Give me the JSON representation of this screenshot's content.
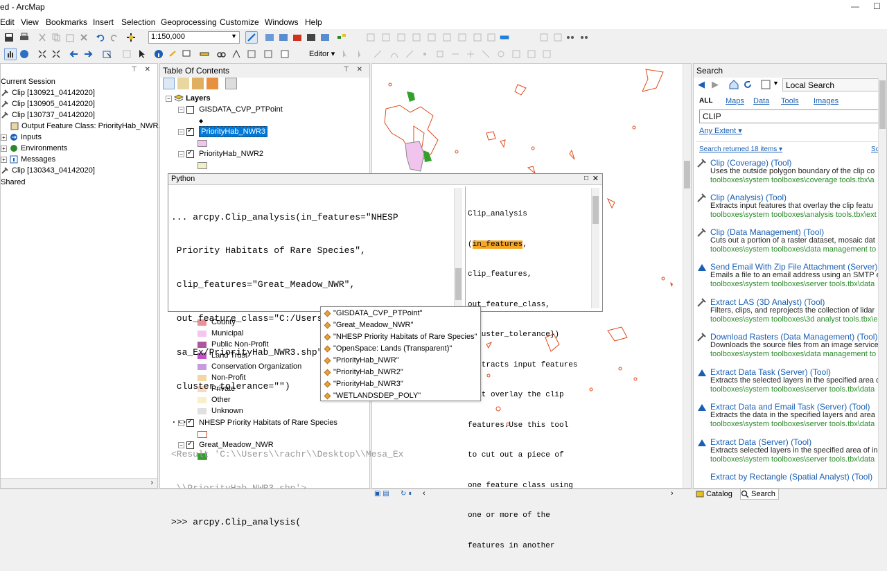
{
  "window": {
    "title": "ed - ArcMap",
    "minimize": "—",
    "maximize": "☐"
  },
  "menu": [
    "Edit",
    "View",
    "Bookmarks",
    "Insert",
    "Selection",
    "Geoprocessing",
    "Customize",
    "Windows",
    "Help"
  ],
  "toolbar": {
    "scale": "1:150,000",
    "editor_label": "Editor ▾"
  },
  "results_panel": {
    "items": [
      {
        "label": "Current Session"
      },
      {
        "label": "Clip [130921_04142020]"
      },
      {
        "label": "Clip [130905_04142020]"
      },
      {
        "label": "Clip [130737_04142020]"
      },
      {
        "label": "Output Feature Class: PriorityHab_NWR.s"
      },
      {
        "label": "Inputs"
      },
      {
        "label": "Environments"
      },
      {
        "label": "Messages"
      },
      {
        "label": "Clip [130343_04142020]"
      },
      {
        "label": "Shared"
      }
    ]
  },
  "toc": {
    "title": "Table Of Contents",
    "root": "Layers",
    "layers": [
      {
        "label": "GISDATA_CVP_PTPoint",
        "checked": false
      },
      {
        "label": "PriorityHab_NWR3",
        "checked": true
      },
      {
        "label": "PriorityHab_NWR2",
        "checked": true
      },
      {
        "label": "NHESP Priority Habitats of Rare Species",
        "checked": true
      },
      {
        "label": "Great_Meadow_NWR",
        "checked": true
      }
    ],
    "legend": [
      {
        "label": "County",
        "color": "#e8929a"
      },
      {
        "label": "Municipal",
        "color": "#f4c6f0"
      },
      {
        "label": "Public Non-Profit",
        "color": "#b0569e"
      },
      {
        "label": "Land Trust",
        "color": "#c34fc9"
      },
      {
        "label": "Conservation Organization",
        "color": "#c79be0"
      },
      {
        "label": "Non-Profit",
        "color": "#f4d6a2"
      },
      {
        "label": "Private",
        "color": "#f9d8c4"
      },
      {
        "label": "Other",
        "color": "#f8f0c8"
      },
      {
        "label": "Unknown",
        "color": "#e0e0e0"
      }
    ]
  },
  "python": {
    "title": "Python",
    "code_lines": [
      "... arcpy.Clip_analysis(in_features=\"NHESP",
      " Priority Habitats of Rare Species\",",
      " clip_features=\"Great_Meadow_NWR\",",
      " out_feature_class=\"C:/Users/rachr/Desktop/Me",
      " sa_Ex/PriorityHab_NWR3.shp\",",
      " cluster_tolerance=\"\")",
      "..."
    ],
    "result_lines": [
      "<Result 'C:\\\\Users\\\\rachr\\\\Desktop\\\\Mesa_Ex",
      " \\\\PriorityHab_NWR3.shp'>"
    ],
    "prompt_line": ">>> arcpy.Clip_analysis(",
    "help_func": "Clip_analysis",
    "help_param": "in_features",
    "help_lines": [
      "clip_features,",
      "out_feature_class,",
      "{cluster_tolerance})",
      " Extracts input features",
      "that overlay the clip",
      "features.Use this tool",
      "to cut out a piece of",
      "one feature class using",
      "one or more of the",
      "features in another"
    ],
    "autocomplete": [
      "\"GISDATA_CVP_PTPoint\"",
      "\"Great_Meadow_NWR\"",
      "\"NHESP Priority Habitats of Rare Species\"",
      "\"OpenSpace: Lands (Transparent)\"",
      "\"PriorityHab_NWR\"",
      "\"PriorityHab_NWR2\"",
      "\"PriorityHab_NWR3\"",
      "\"WETLANDSDEP_POLY\""
    ]
  },
  "search": {
    "title": "Search",
    "scope": "Local Search",
    "filters": [
      "ALL",
      "Maps",
      "Data",
      "Tools",
      "Images"
    ],
    "query": "CLIP",
    "extent": "Any Extent ▾",
    "count": "Search returned 18 items ▾",
    "sort": "So",
    "results": [
      {
        "name": "Clip",
        "kind": "(Coverage)",
        "type": "(Tool)",
        "desc": "Uses the outside polygon boundary of the clip co",
        "path": "toolboxes\\system toolboxes\\coverage tools.tbx\\a"
      },
      {
        "name": "Clip",
        "kind": "(Analysis)",
        "type": "(Tool)",
        "desc": "Extracts input features that overlay the clip featu",
        "path": "toolboxes\\system toolboxes\\analysis tools.tbx\\ext"
      },
      {
        "name": "Clip",
        "kind": "(Data Management)",
        "type": "(Tool)",
        "desc": "Cuts out a portion of a raster dataset, mosaic dat",
        "path": "toolboxes\\system toolboxes\\data management to"
      },
      {
        "name": "Send Email With Zip File Attachment",
        "kind": "(Server)",
        "type": "",
        "desc": "Emails a file to an email address using an SMTP e",
        "path": "toolboxes\\system toolboxes\\server tools.tbx\\data"
      },
      {
        "name": "Extract LAS",
        "kind": "(3D Analyst)",
        "type": "(Tool)",
        "desc": "Filters, clips, and reprojects the collection of lidar",
        "path": "toolboxes\\system toolboxes\\3d analyst tools.tbx\\e"
      },
      {
        "name": "Download Rasters",
        "kind": "(Data Management)",
        "type": "(Tool)",
        "desc": "Downloads the source files from an image service",
        "path": "toolboxes\\system toolboxes\\data management to"
      },
      {
        "name": "Extract Data Task",
        "kind": "(Server)",
        "type": "(Tool)",
        "desc": "Extracts the selected layers in the specified area o",
        "path": "toolboxes\\system toolboxes\\server tools.tbx\\data"
      },
      {
        "name": "Extract Data and Email Task",
        "kind": "(Server)",
        "type": "(Tool)",
        "desc": "Extracts the data in the specified layers and area",
        "path": "toolboxes\\system toolboxes\\server tools.tbx\\data"
      },
      {
        "name": "Extract Data",
        "kind": "(Server)",
        "type": "(Tool)",
        "desc": "Extracts selected layers in the specified area of in",
        "path": "toolboxes\\system toolboxes\\server tools.tbx\\data"
      },
      {
        "name": "Extract by Rectangle",
        "kind": "(Spatial Analyst)",
        "type": "(Tool)",
        "desc": "",
        "path": ""
      }
    ],
    "tabs": [
      "Catalog",
      "Search"
    ]
  },
  "colors": {
    "selection": "#0078d7",
    "link": "#1a5fb4",
    "path": "#2a8a2a",
    "highlight": "#f5a623",
    "polygon_outline": "#e04a1a",
    "green_feature": "#33a02c",
    "pink_feature": "#f0c4ec"
  }
}
